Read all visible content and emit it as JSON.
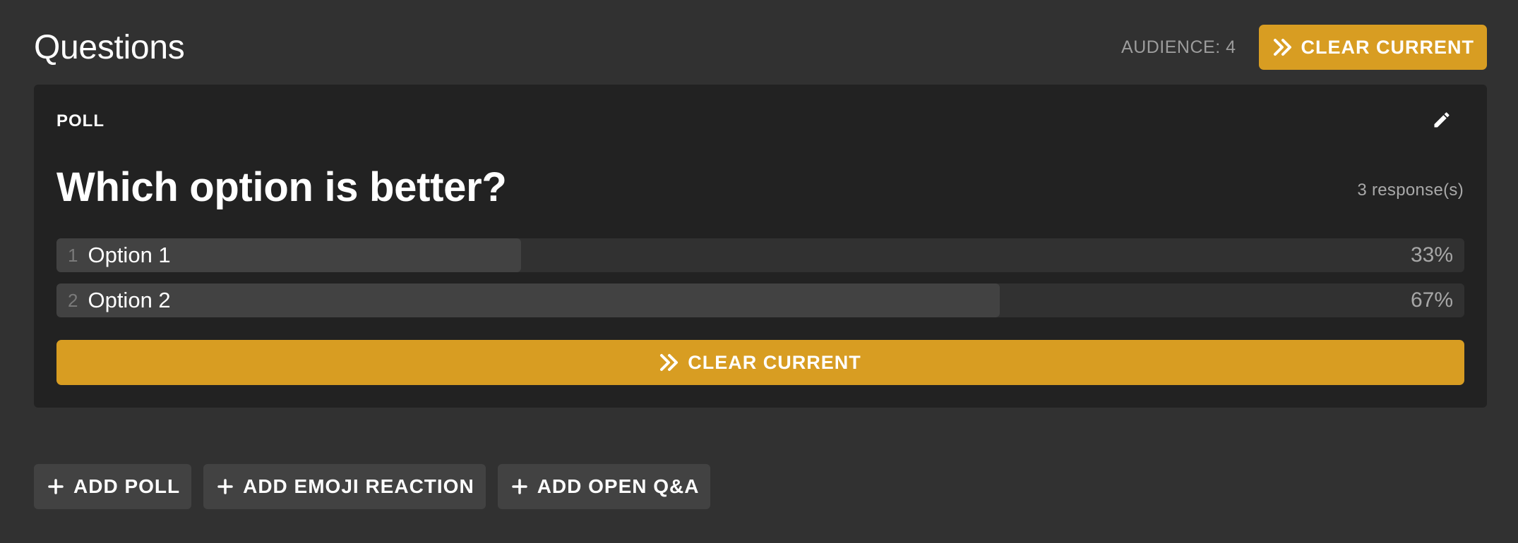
{
  "header": {
    "title": "Questions",
    "audience": "AUDIENCE: 4",
    "clear_label": "CLEAR CURRENT"
  },
  "card": {
    "type_label": "POLL",
    "question": "Which option is better?",
    "responses": "3 response(s)",
    "options": [
      {
        "num": "1",
        "label": "Option 1",
        "percent": "33%",
        "share": 0.33
      },
      {
        "num": "2",
        "label": "Option 2",
        "percent": "67%",
        "share": 0.67
      }
    ],
    "clear_label": "CLEAR CURRENT"
  },
  "actions": {
    "add_poll": "ADD POLL",
    "add_emoji": "ADD EMOJI REACTION",
    "add_qa": "ADD OPEN Q&A"
  },
  "icons": {
    "clear": "double-chevron-right-icon",
    "edit": "pencil-icon",
    "add": "plus-icon"
  },
  "colors": {
    "background": "#313131",
    "card": "#222222",
    "accent": "#d89d22",
    "bar_track": "#313131",
    "bar_fill": "#424242",
    "secondary_button": "#424242"
  }
}
